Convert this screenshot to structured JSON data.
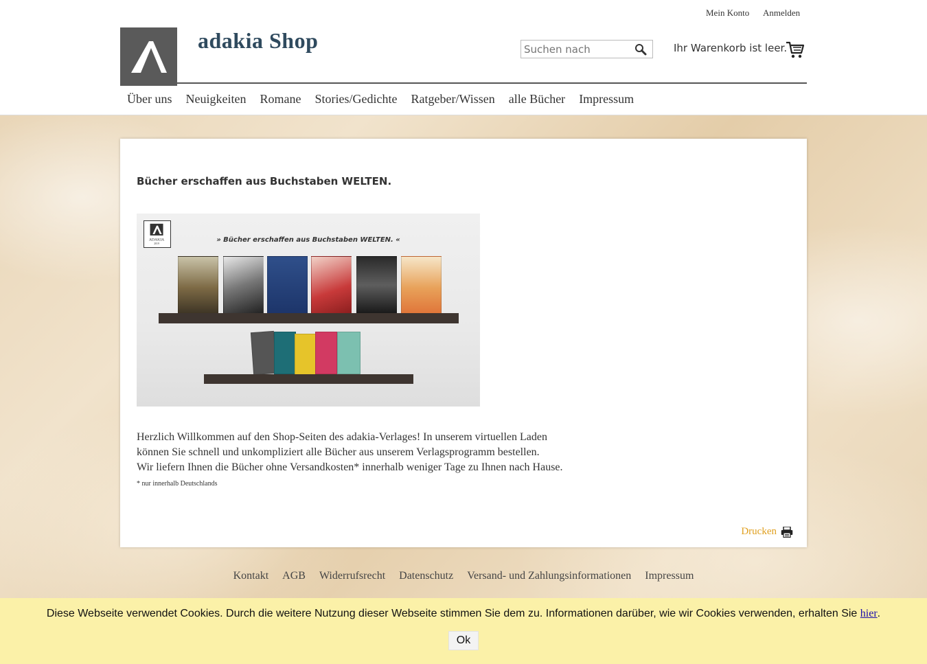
{
  "top_links": {
    "account": "Mein Konto",
    "login": "Anmelden"
  },
  "header": {
    "shop_title": "adakia Shop",
    "search_placeholder": "Suchen nach",
    "cart_text": "Ihr Warenkorb ist leer."
  },
  "nav": [
    "Über uns",
    "Neuigkeiten",
    "Romane",
    "Stories/Gedichte",
    "Ratgeber/Wissen",
    "alle Bücher",
    "Impressum"
  ],
  "main": {
    "headline": "Bücher erschaffen aus Buchstaben WELTEN.",
    "hero_caption": "» Bücher erschaffen aus Buchstaben WELTEN. «",
    "hero_logo_text": "ADAKIA",
    "hero_logo_year": "2019",
    "intro_lines": [
      "Herzlich Willkommen auf den Shop-Seiten des adakia-Verlages! In unserem virtuellen Laden",
      "können Sie schnell und unkompliziert alle Bücher aus unserem Verlagsprogramm bestellen.",
      "Wir liefern Ihnen die Bücher ohne Versandkosten* innerhalb weniger Tage zu Ihnen nach Hause."
    ],
    "footnote": "* nur innerhalb Deutschlands",
    "print_label": "Drucken"
  },
  "footer_nav": [
    "Kontakt",
    "AGB",
    "Widerrufsrecht",
    "Datenschutz",
    "Versand- und Zahlungsinformationen",
    "Impressum"
  ],
  "cookie": {
    "text": "Diese Webseite verwendet Cookies. Durch die weitere Nutzung dieser Webseite stimmen Sie dem zu. Informationen darüber, wie wir Cookies verwenden, erhalten Sie ",
    "link": "hier",
    "suffix": ".",
    "ok": "Ok"
  },
  "colors": {
    "logo_bg": "#5a5a5a",
    "title": "#2f4a5e",
    "print_link": "#e0a020",
    "cookie_bg": "#fbf1a8"
  }
}
